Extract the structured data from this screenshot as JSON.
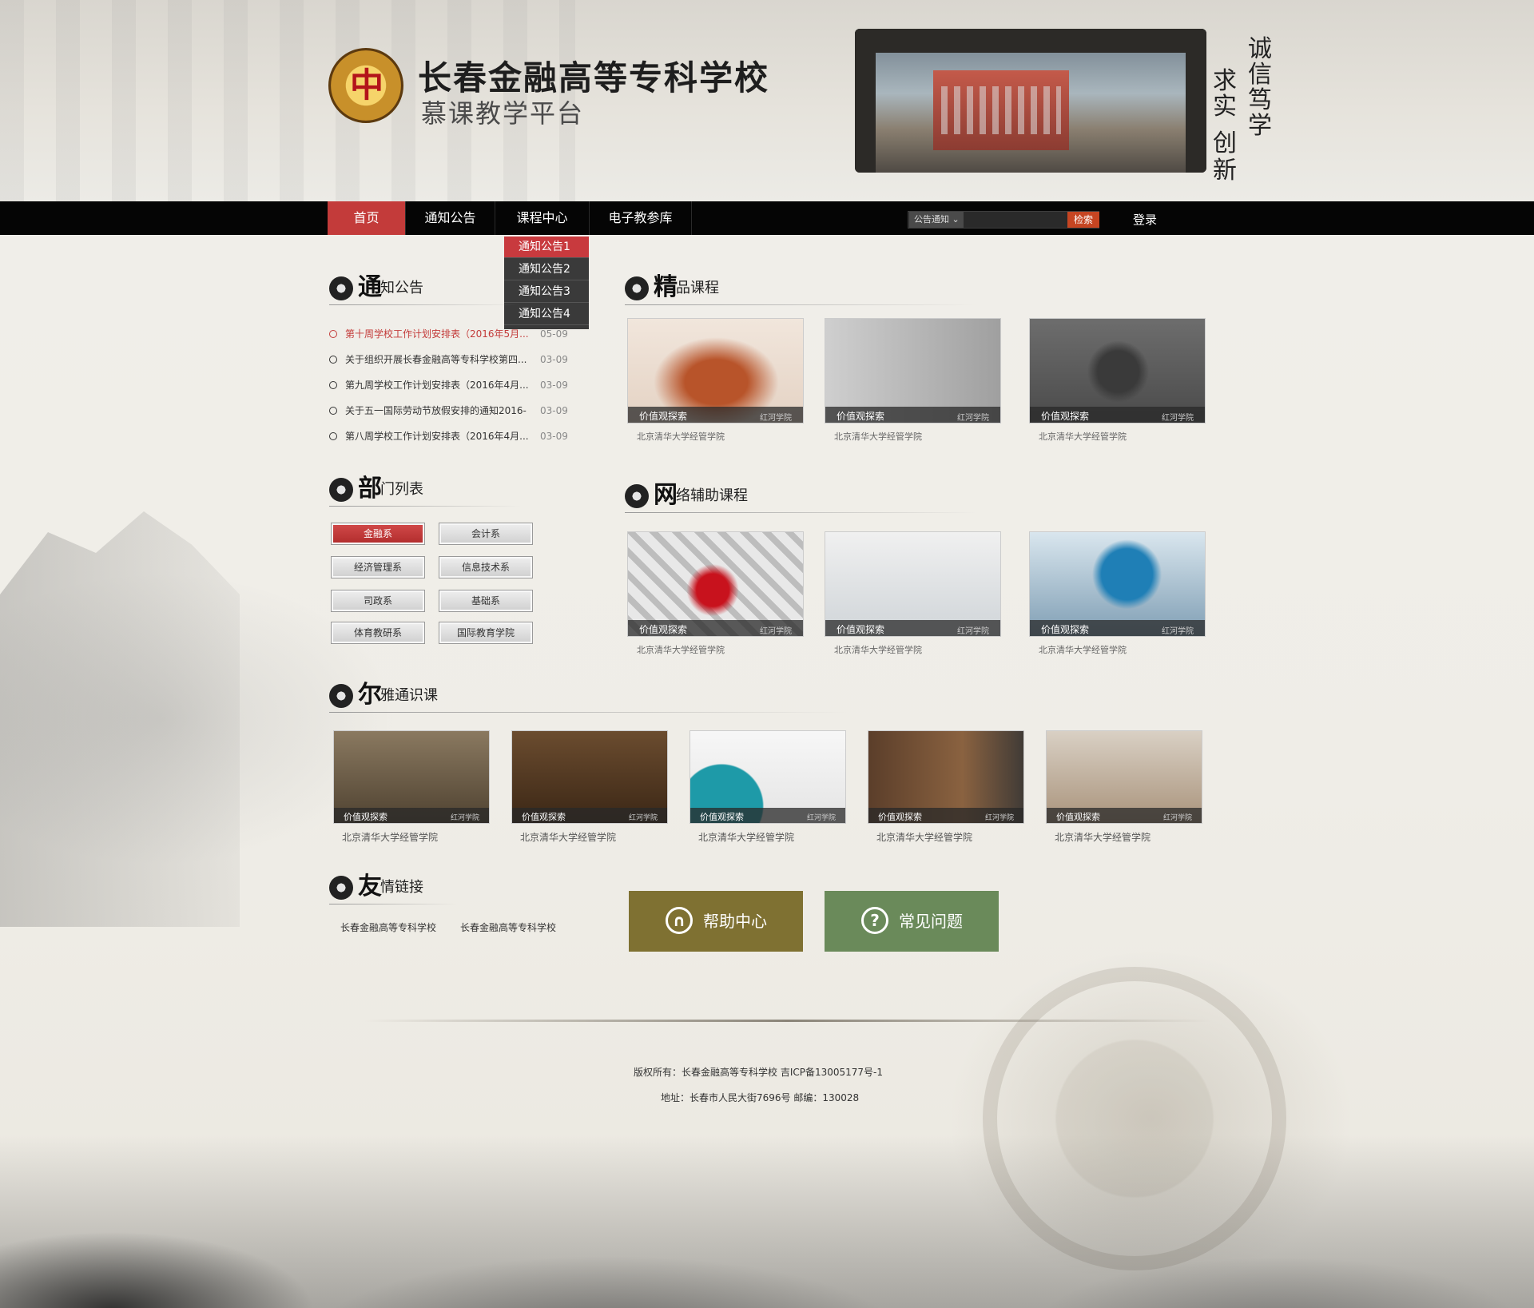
{
  "header": {
    "school_name": "长春金融高等专科学校",
    "platform_name": "慕课教学平台",
    "logo_glyph": "中",
    "motto": [
      "诚",
      "信",
      "笃",
      "学",
      "求",
      "实",
      "创",
      "新"
    ]
  },
  "nav": {
    "items": [
      {
        "label": "首页",
        "active": true
      },
      {
        "label": "通知公告",
        "active": false
      },
      {
        "label": "课程中心",
        "active": false
      },
      {
        "label": "电子教参库",
        "active": false
      }
    ],
    "search": {
      "scope": "公告通知",
      "button": "检索",
      "placeholder": ""
    },
    "login": "登录",
    "dropdown": [
      {
        "label": "通知公告1",
        "active": true
      },
      {
        "label": "通知公告2",
        "active": false
      },
      {
        "label": "通知公告3",
        "active": false
      },
      {
        "label": "通知公告4",
        "active": false
      }
    ]
  },
  "notices": {
    "title_big": "通",
    "title_rest": "知公告",
    "items": [
      {
        "text": "第十周学校工作计划安排表（2016年5月...",
        "date": "05-09",
        "hot": true
      },
      {
        "text": "关于组织开展长春金融高等专科学校第四...",
        "date": "03-09",
        "hot": false
      },
      {
        "text": "第九周学校工作计划安排表（2016年4月...",
        "date": "03-09",
        "hot": false
      },
      {
        "text": "关于五一国际劳动节放假安排的通知2016-",
        "date": "03-09",
        "hot": false
      },
      {
        "text": "第八周学校工作计划安排表（2016年4月...",
        "date": "03-09",
        "hot": false
      }
    ]
  },
  "departments": {
    "title_big": "部",
    "title_rest": "门列表",
    "items": [
      {
        "label": "金融系",
        "active": true
      },
      {
        "label": "会计系",
        "active": false
      },
      {
        "label": "经济管理系",
        "active": false
      },
      {
        "label": "信息技术系",
        "active": false
      },
      {
        "label": "司政系",
        "active": false
      },
      {
        "label": "基础系",
        "active": false
      },
      {
        "label": "体育教研系",
        "active": false
      },
      {
        "label": "国际教育学院",
        "active": false
      }
    ]
  },
  "featured": {
    "title_big": "精",
    "title_rest": "品课程",
    "cards": [
      {
        "tag": "价值观探索",
        "brand": "红河学院",
        "caption": "北京清华大学经管学院"
      },
      {
        "tag": "价值观探索",
        "brand": "红河学院",
        "caption": "北京清华大学经管学院"
      },
      {
        "tag": "价值观探索",
        "brand": "红河学院",
        "caption": "北京清华大学经管学院"
      }
    ]
  },
  "online": {
    "title_big": "网",
    "title_rest": "络辅助课程",
    "cards": [
      {
        "tag": "价值观探索",
        "brand": "红河学院",
        "caption": "北京清华大学经管学院"
      },
      {
        "tag": "价值观探索",
        "brand": "红河学院",
        "caption": "北京清华大学经管学院"
      },
      {
        "tag": "价值观探索",
        "brand": "红河学院",
        "caption": "北京清华大学经管学院"
      }
    ]
  },
  "general": {
    "title_big": "尔",
    "title_rest": "雅通识课",
    "cards": [
      {
        "tag": "价值观探索",
        "brand": "红河学院",
        "caption": "北京清华大学经管学院"
      },
      {
        "tag": "价值观探索",
        "brand": "红河学院",
        "caption": "北京清华大学经管学院"
      },
      {
        "tag": "价值观探索",
        "brand": "红河学院",
        "caption": "北京清华大学经管学院"
      },
      {
        "tag": "价值观探索",
        "brand": "红河学院",
        "caption": "北京清华大学经管学院"
      },
      {
        "tag": "价值观探索",
        "brand": "红河学院",
        "caption": "北京清华大学经管学院"
      }
    ]
  },
  "links": {
    "title_big": "友",
    "title_rest": "情链接",
    "items": [
      "长春金融高等专科学校",
      "长春金融高等专科学校"
    ]
  },
  "help": {
    "help_center": "帮助中心",
    "faq": "常见问题",
    "help_color": "#7f7132",
    "faq_color": "#6a8a5a"
  },
  "footer": {
    "copyright": "版权所有：长春金融高等专科学校     吉ICP备13005177号-1",
    "address": "地址：长春市人民大街7696号     邮编：130028"
  },
  "colors": {
    "accent_red": "#c33b3a",
    "nav_bg": "#050505",
    "search_btn": "#c64522"
  }
}
